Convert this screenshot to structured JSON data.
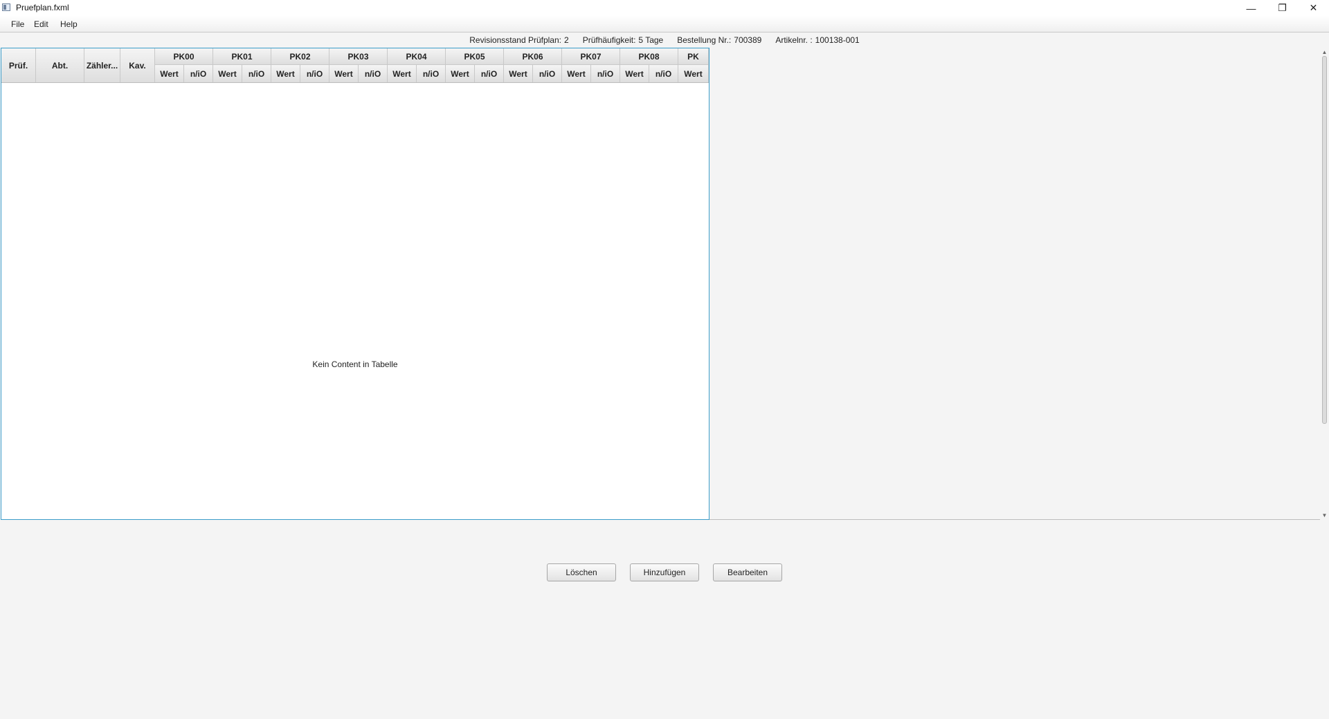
{
  "window": {
    "title": "Pruefplan.fxml",
    "minimize_glyph": "—",
    "maximize_glyph": "❐",
    "close_glyph": "✕"
  },
  "menu": {
    "items": [
      {
        "label": "File"
      },
      {
        "label": "Edit"
      },
      {
        "label": "Help"
      }
    ]
  },
  "info": {
    "revision_label": "Revisionsstand Prüfplan:",
    "revision_value": "2",
    "frequency_label": "Prüfhäufigkeit:",
    "frequency_value": "5 Tage",
    "order_label": "Bestellung Nr.:",
    "order_value": "700389",
    "article_label": "Artikelnr. :",
    "article_value": "100138-001"
  },
  "table": {
    "fixed_columns": [
      {
        "label": "Prüf."
      },
      {
        "label": "Abt."
      },
      {
        "label": "Zähler..."
      },
      {
        "label": "Kav."
      }
    ],
    "groups": [
      {
        "label": "PK00",
        "sub": [
          "Wert",
          "n/iO"
        ]
      },
      {
        "label": "PK01",
        "sub": [
          "Wert",
          "n/iO"
        ]
      },
      {
        "label": "PK02",
        "sub": [
          "Wert",
          "n/iO"
        ]
      },
      {
        "label": "PK03",
        "sub": [
          "Wert",
          "n/iO"
        ]
      },
      {
        "label": "PK04",
        "sub": [
          "Wert",
          "n/iO"
        ]
      },
      {
        "label": "PK05",
        "sub": [
          "Wert",
          "n/iO"
        ]
      },
      {
        "label": "PK06",
        "sub": [
          "Wert",
          "n/iO"
        ]
      },
      {
        "label": "PK07",
        "sub": [
          "Wert",
          "n/iO"
        ]
      },
      {
        "label": "PK08",
        "sub": [
          "Wert",
          "n/iO"
        ]
      },
      {
        "label": "PK",
        "sub": [
          "Wert"
        ]
      }
    ],
    "placeholder": "Kein Content in Tabelle"
  },
  "buttons": {
    "delete": "Löschen",
    "add": "Hinzufügen",
    "edit": "Bearbeiten"
  }
}
